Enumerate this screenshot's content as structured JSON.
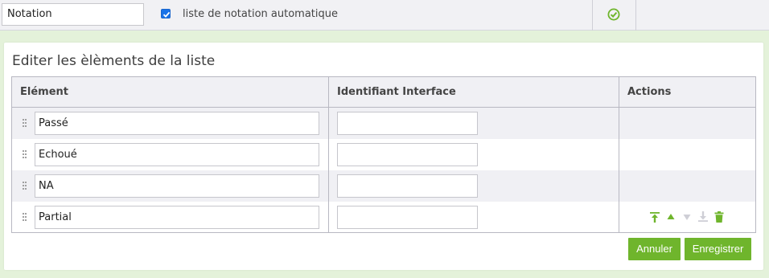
{
  "topbar": {
    "name_value": "Notation",
    "auto_checkbox_checked": true,
    "auto_label": "liste de notation automatique",
    "validate_icon": "check-circle-icon"
  },
  "panel": {
    "title": "Editer les èlèments de la liste",
    "columns": [
      "Elément",
      "Identifiant Interface",
      "Actions"
    ],
    "rows": [
      {
        "element": "Passé",
        "identifiant": ""
      },
      {
        "element": "Echoué",
        "identifiant": ""
      },
      {
        "element": "NA",
        "identifiant": ""
      },
      {
        "element": "Partial",
        "identifiant": ""
      }
    ],
    "row_actions": [
      "move-top-icon",
      "move-up-icon",
      "move-down-icon",
      "move-bottom-icon",
      "trash-icon"
    ],
    "buttons": {
      "cancel": "Annuler",
      "save": "Enregistrer"
    }
  },
  "colors": {
    "accent": "#6fb52c",
    "checkbox": "#1a73e8",
    "header_bg": "#f0f0f4",
    "page_bg": "#e4f2da"
  }
}
